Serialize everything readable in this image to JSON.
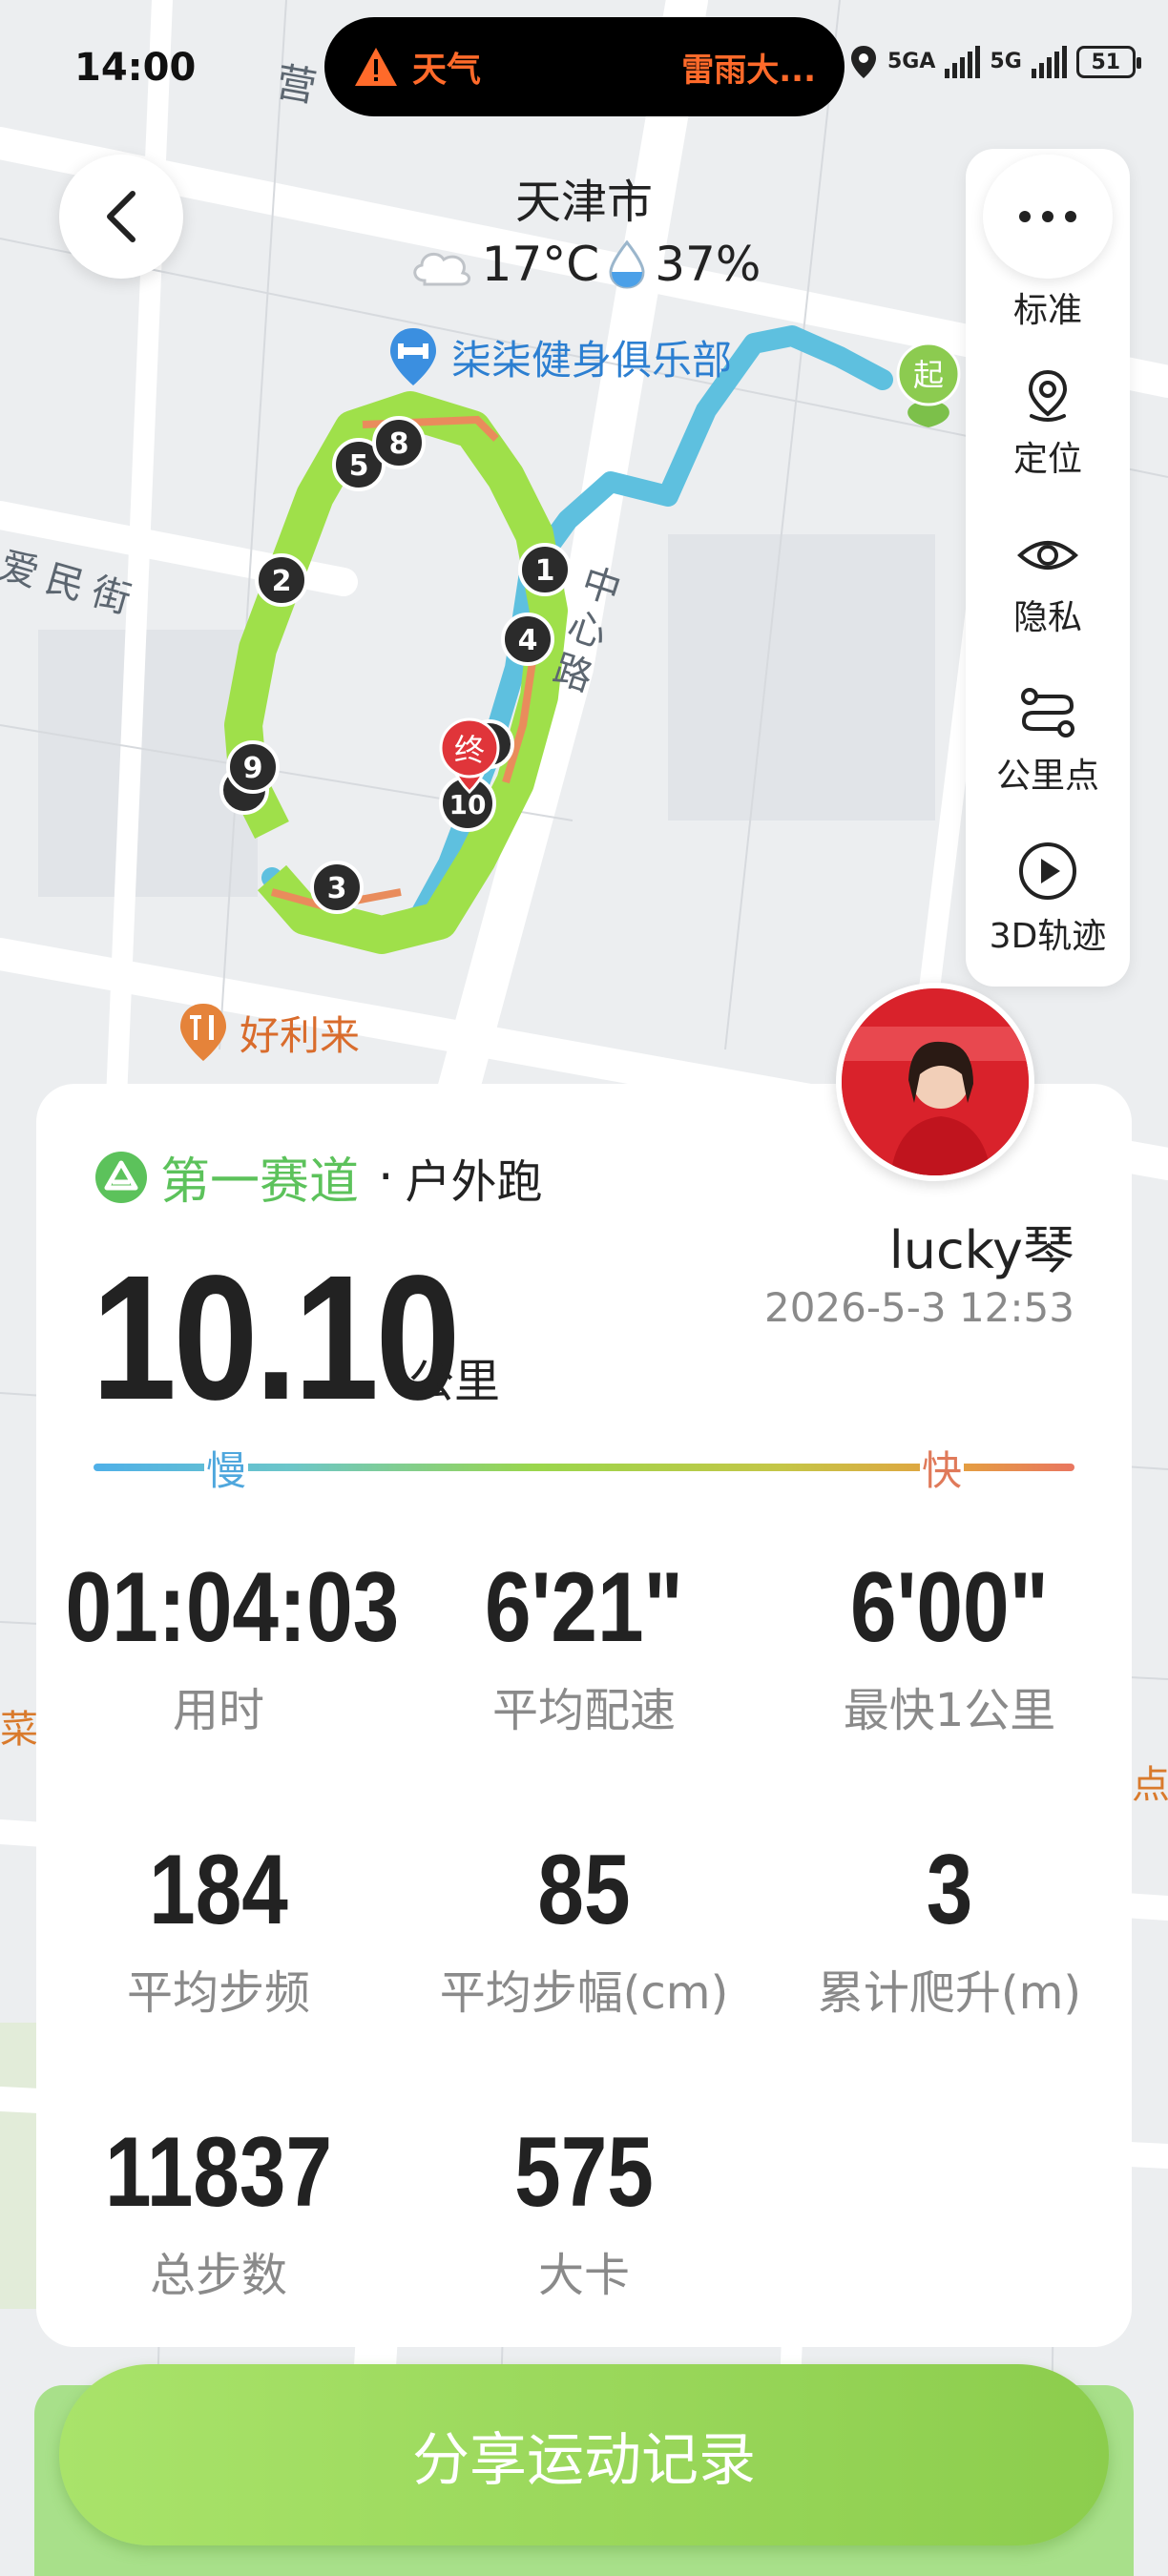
{
  "status_bar": {
    "time": "14:00",
    "alert_label": "天气",
    "alert_text": "雷雨大...",
    "signal1": "5GA",
    "signal2": "5G",
    "battery": "51"
  },
  "header": {
    "city": "天津市",
    "temperature": "17°C",
    "humidity": "37%"
  },
  "map": {
    "poi_club": "柒柒健身俱乐部",
    "poi_haolilai": "好利来",
    "road_aimin": "爱民街",
    "road_zhongxin": "中心路",
    "road_ying": "营",
    "edge_cai": "菜",
    "edge_dian": "点",
    "start_marker": "起",
    "end_marker": "终",
    "km_markers": [
      "1",
      "2",
      "3",
      "4",
      "5",
      "8",
      "9",
      "10"
    ]
  },
  "toolbar": {
    "standard": "标准",
    "locate": "定位",
    "privacy": "隐私",
    "km_points": "公里点",
    "track_3d": "3D轨迹"
  },
  "card": {
    "brand": "第一赛道",
    "separator": "·",
    "activity_type": "户外跑",
    "distance": "10.10",
    "distance_unit": "公里",
    "user_name": "lucky琴",
    "date": "2026-5-3 12:53",
    "pace_slow": "慢",
    "pace_fast": "快",
    "stats": [
      {
        "value": "01:04:03",
        "label": "用时"
      },
      {
        "value": "6'21\"",
        "label": "平均配速"
      },
      {
        "value": "6'00\"",
        "label": "最快1公里"
      },
      {
        "value": "184",
        "label": "平均步频"
      },
      {
        "value": "85",
        "label": "平均步幅(cm)"
      },
      {
        "value": "3",
        "label": "累计爬升(m)"
      },
      {
        "value": "11837",
        "label": "总步数"
      },
      {
        "value": "575",
        "label": "大卡"
      }
    ]
  },
  "share_button": "分享运动记录",
  "colors": {
    "brand_green": "#5cc25b",
    "route_slow": "#4fb0e8",
    "route_fast": "#e97660",
    "share_green": "#9bd85c"
  }
}
